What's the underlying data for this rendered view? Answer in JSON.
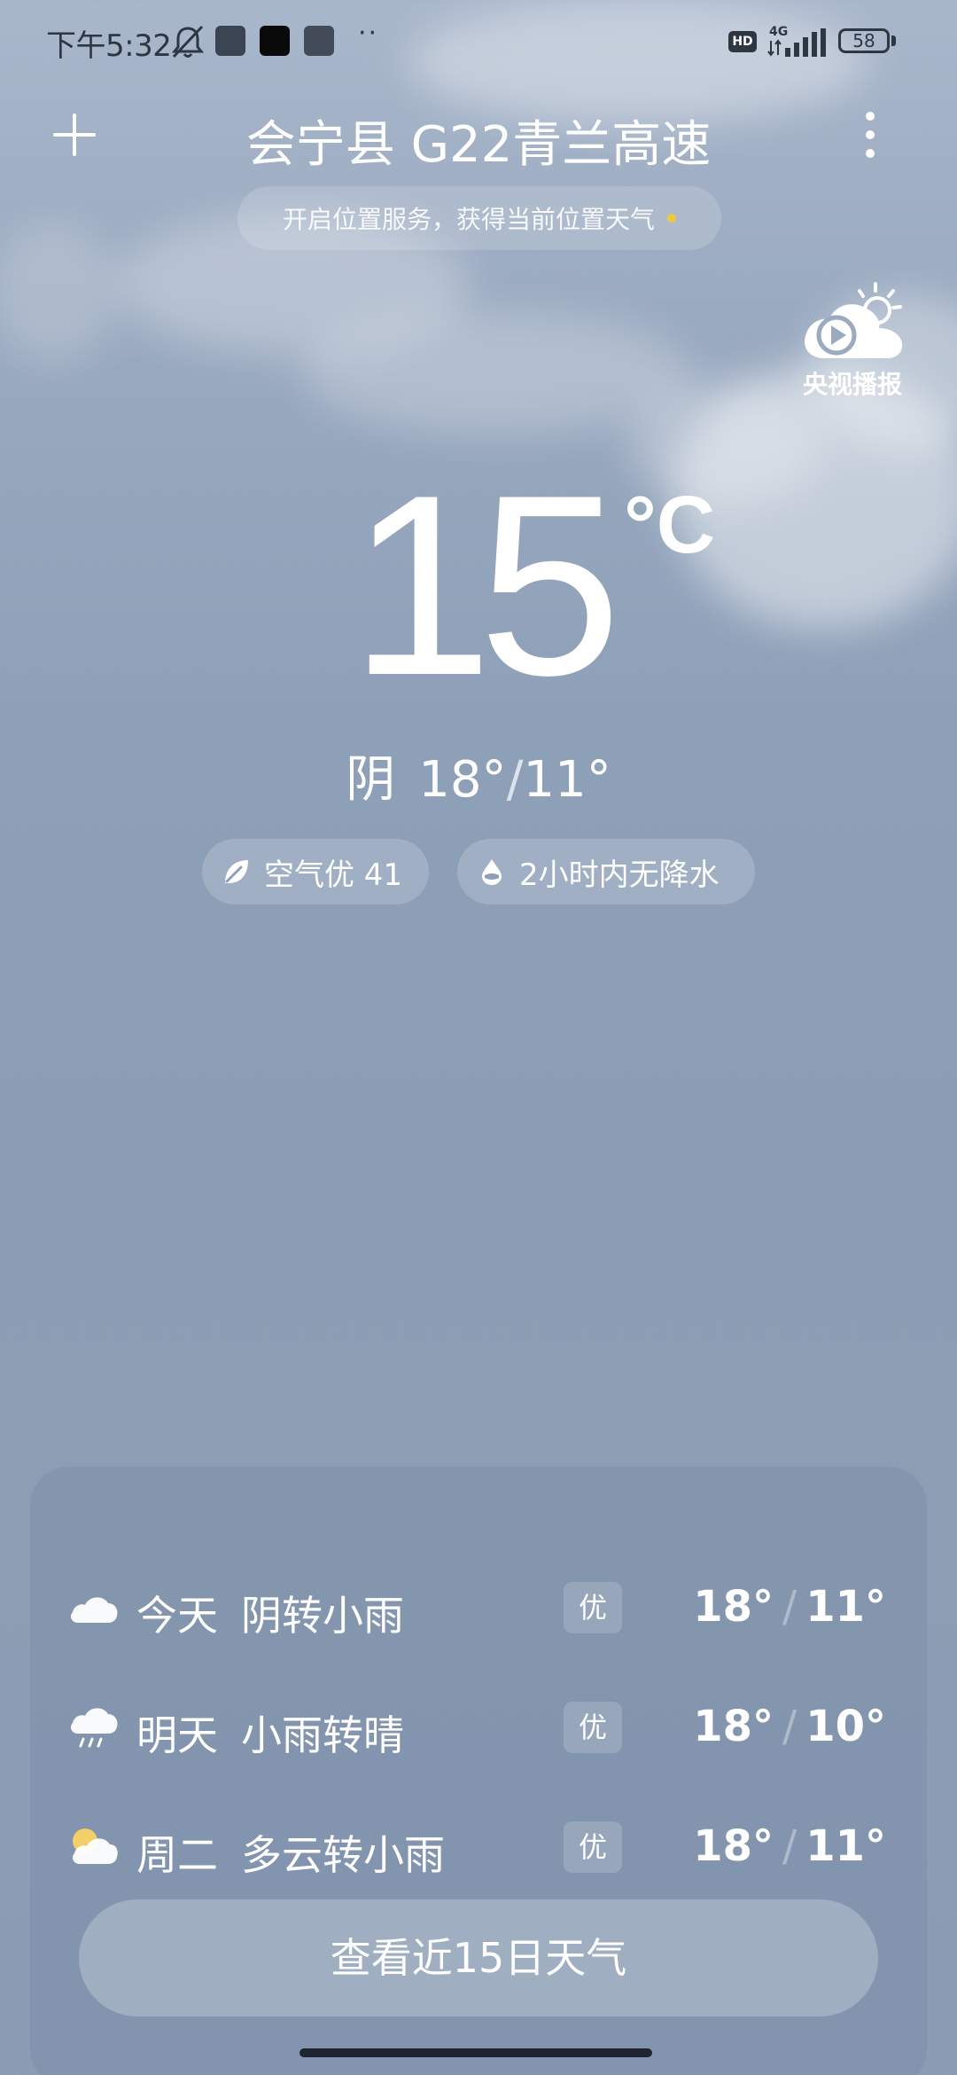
{
  "status_bar": {
    "time": "下午5:32",
    "network": "4G",
    "hd_badge": "HD",
    "battery": "58",
    "more_indicator": "··"
  },
  "header": {
    "location": "会宁县 G22青兰高速",
    "location_hint": "开启位置服务，获得当前位置天气",
    "cctv_label": "央视播报"
  },
  "current": {
    "temperature": "15",
    "unit": "°C",
    "condition": "阴",
    "high": "18°",
    "low": "11°",
    "separator": "/",
    "air_quality": "空气优 41",
    "precipitation": "2小时内无降水"
  },
  "forecast": [
    {
      "day": "今天",
      "condition": "阴转小雨",
      "aqi": "优",
      "high": "18°",
      "low": "11°",
      "icon": "cloudy-icon"
    },
    {
      "day": "明天",
      "condition": "小雨转晴",
      "aqi": "优",
      "high": "18°",
      "low": "10°",
      "icon": "light-rain-icon"
    },
    {
      "day": "周二",
      "condition": "多云转小雨",
      "aqi": "优",
      "high": "18°",
      "low": "11°",
      "icon": "partly-cloudy-icon"
    }
  ],
  "forecast_slash": "/",
  "view_15_days": "查看近15日天气",
  "colors": {
    "sky_top": "#a9b7cb",
    "sky_bottom": "#8a9bb3",
    "hint_dot": "#f0c83a",
    "status_text": "#2e3642"
  }
}
